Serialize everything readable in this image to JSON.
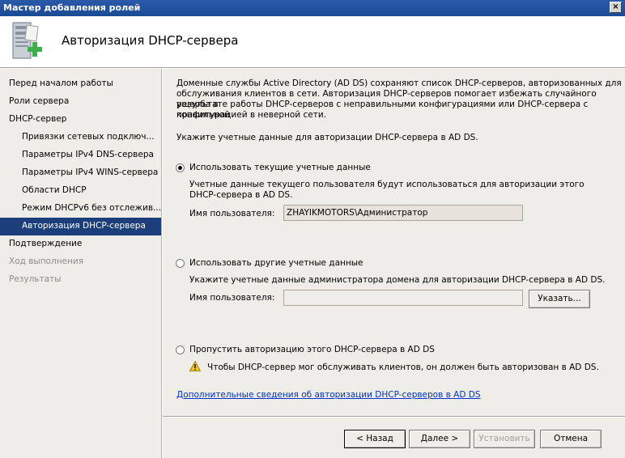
{
  "window": {
    "title": "Мастер добавления ролей",
    "close_glyph": "×"
  },
  "header": {
    "title": "Авторизация DHCP-сервера",
    "icon": "server-add-icon"
  },
  "sidebar": {
    "items": [
      {
        "label": "Перед началом работы",
        "state": "normal"
      },
      {
        "label": "Роли сервера",
        "state": "normal"
      },
      {
        "label": "DHCP-сервер",
        "state": "normal"
      },
      {
        "label": "Привязки сетевых подключ...",
        "state": "sub"
      },
      {
        "label": "Параметры IPv4 DNS-сервера",
        "state": "sub"
      },
      {
        "label": "Параметры IPv4 WINS-сервера",
        "state": "sub"
      },
      {
        "label": "Области DHCP",
        "state": "sub"
      },
      {
        "label": "Режим DHCPv6 без отслежив...",
        "state": "sub"
      },
      {
        "label": "Авторизация DHCP-сервера",
        "state": "sub-active"
      },
      {
        "label": "Подтверждение",
        "state": "normal"
      },
      {
        "label": "Ход выполнения",
        "state": "disabled"
      },
      {
        "label": "Результаты",
        "state": "disabled"
      }
    ]
  },
  "main": {
    "intro": [
      "Доменные службы Active Directory (AD DS) сохраняют список DHCP-серверов, авторизованных для",
      "обслуживания клиентов в сети. Авторизация DHCP-серверов помогает избежать случайного ущерба в",
      "результате работы DHCP-серверов с неправильными конфигурациями или DHCP-сервера с правильной",
      "конфигурацией в неверной сети."
    ],
    "prompt": "Укажите учетные данные для авторизации DHCP-сервера в AD DS.",
    "option_current": {
      "label": "Использовать текущие учетные данные",
      "desc": [
        "Учетные данные текущего пользователя будут использоваться для авторизации этого",
        "DHCP-сервера в AD DS."
      ],
      "username_label": "Имя пользователя:",
      "username_value": "ZHAYIKMOTORS\\Администратор",
      "selected": true
    },
    "option_other": {
      "label": "Использовать другие учетные данные",
      "desc": "Укажите учетные данные администратора домена для авторизации DHCP-сервера в AD DS.",
      "username_label": "Имя пользователя:",
      "username_value": "",
      "specify_button": "Указать...",
      "selected": false
    },
    "option_skip": {
      "label": "Пропустить авторизацию этого DHCP-сервера в AD DS",
      "warning": "Чтобы DHCP-сервер мог обслуживать клиентов, он должен быть авторизован в AD DS.",
      "selected": false
    },
    "more_info_link": "Дополнительные сведения об авторизации DHCP-серверов в AD DS"
  },
  "footer": {
    "back": "< Назад",
    "next": "Далее >",
    "install": "Установить",
    "cancel": "Отмена"
  }
}
